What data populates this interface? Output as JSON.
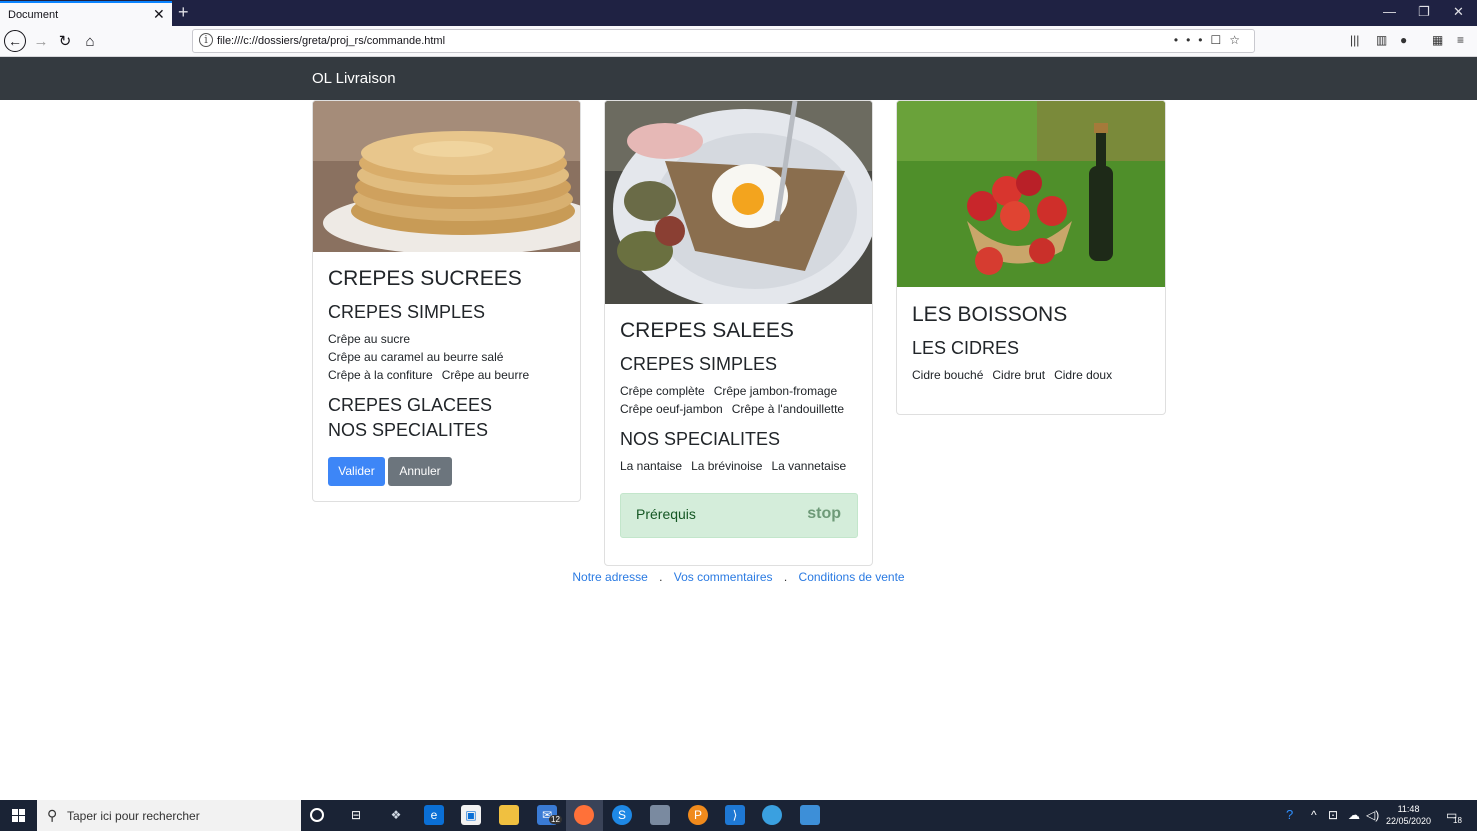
{
  "browser": {
    "tab_title": "Document",
    "tab_close": "✕",
    "new_tab": "+",
    "url": "file:///c://dossiers/greta/proj_rs/commande.html",
    "window_controls": {
      "minimize": "—",
      "restore": "❐",
      "close": "✕"
    }
  },
  "site": {
    "brand": "OL Livraison"
  },
  "cards": {
    "sucrees": {
      "title": "CREPES SUCREES",
      "simples_title": "CREPES SIMPLES",
      "items": [
        "Crêpe au sucre",
        "Crêpe au caramel au beurre salé",
        "Crêpe à la confiture",
        "Crêpe au beurre"
      ],
      "glacees_title": "CREPES GLACEES",
      "specialites_title": "NOS SPECIALITES",
      "validate_label": "Valider",
      "cancel_label": "Annuler"
    },
    "salees": {
      "title": "CREPES SALEES",
      "simples_title": "CREPES SIMPLES",
      "items": [
        "Crêpe complète",
        "Crêpe jambon-fromage",
        "Crêpe oeuf-jambon",
        "Crêpe à l'andouillette"
      ],
      "specialites_title": "NOS SPECIALITES",
      "specialites": [
        "La nantaise",
        "La brévinoise",
        "La vannetaise"
      ],
      "alert_text": "Prérequis",
      "alert_stop": "stop"
    },
    "boissons": {
      "title": "LES BOISSONS",
      "cidres_title": "LES CIDRES",
      "items": [
        "Cidre bouché",
        "Cidre brut",
        "Cidre doux"
      ]
    }
  },
  "footer": {
    "links": [
      "Notre adresse",
      "Vos commentaires",
      "Conditions de vente"
    ],
    "separator": "."
  },
  "taskbar": {
    "search_placeholder": "Taper ici pour rechercher",
    "mail_badge": "12",
    "time": "11:48",
    "date": "22/05/2020",
    "notif_count": "18"
  },
  "colors": {
    "navbar": "#343a40",
    "primary": "#3d86f7",
    "secondary": "#6c757d",
    "alert_bg": "#d4edda",
    "link": "#2a7ae2"
  }
}
